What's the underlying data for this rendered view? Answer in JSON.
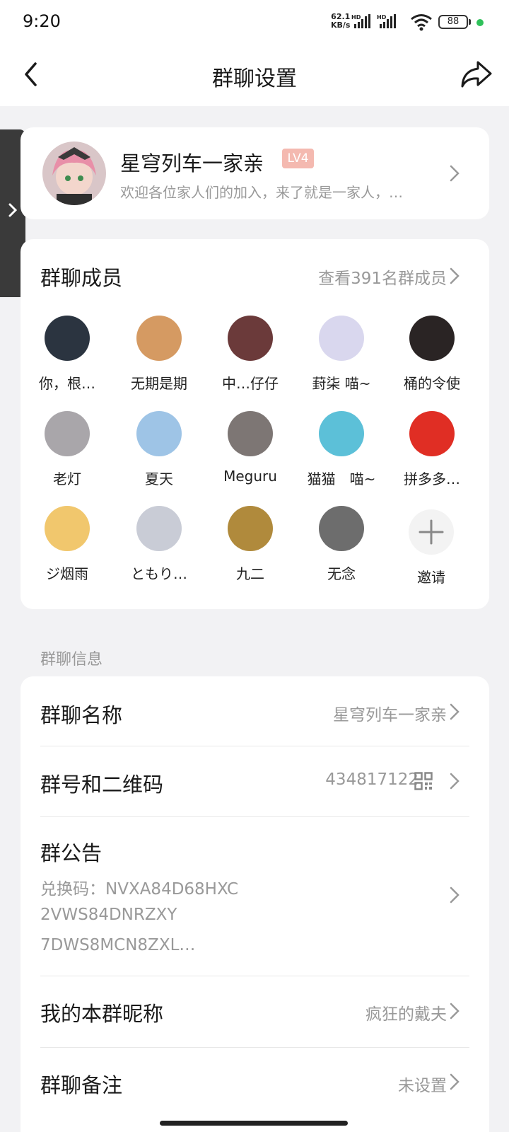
{
  "status_bar": {
    "time": "9:20",
    "net_speed_value": "62.1",
    "net_speed_unit": "KB/s",
    "signal_1_label": "HD",
    "signal_2_label": "HD",
    "battery": "88"
  },
  "header": {
    "title": "群聊设置",
    "back_icon": "chevron-left-icon",
    "share_icon": "share-arrow-icon"
  },
  "group": {
    "name": "星穹列车一家亲",
    "level_badge": "LV4",
    "description": "欢迎各位家人们的加入，来了就是一家人，…"
  },
  "members": {
    "title": "群聊成员",
    "view_all": "查看391名群成员",
    "list": [
      {
        "name": "你，根…",
        "color": "#2b3440"
      },
      {
        "name": "无期是期",
        "color": "#d59a62"
      },
      {
        "name": "中…仔仔",
        "color": "#6b3a3a"
      },
      {
        "name": "葑柒 喵~",
        "color": "#d9d7ee"
      },
      {
        "name": "桶的令使",
        "color": "#2a2424"
      },
      {
        "name": "老灯",
        "color": "#a9a6aa"
      },
      {
        "name": "夏天",
        "color": "#9ec4e6"
      },
      {
        "name": "Meguru",
        "color": "#7d7674"
      },
      {
        "name": "猫猫　喵~",
        "color": "#5cc0d8"
      },
      {
        "name": "拼多多…",
        "color": "#e02e24"
      },
      {
        "name": "ジ烟雨",
        "color": "#f1c76d"
      },
      {
        "name": "ともり…",
        "color": "#c9ccd6"
      },
      {
        "name": "九二",
        "color": "#b08a3c"
      },
      {
        "name": "无念",
        "color": "#6d6d6d"
      }
    ],
    "invite_label": "邀请"
  },
  "info_section": {
    "label": "群聊信息",
    "group_name_label": "群聊名称",
    "group_name_value": "星穹列车一家亲",
    "group_id_label": "群号和二维码",
    "group_id_value": "434817122",
    "notice_label": "群公告",
    "notice_line1": "兑换码：NVXA84D68HXC",
    "notice_line2": "2VWS84DNRZXY",
    "notice_line3": "7DWS8MCN8ZXL…",
    "nickname_label": "我的本群昵称",
    "nickname_value": "疯狂的戴夫",
    "remark_label": "群聊备注",
    "remark_value": "未设置"
  }
}
